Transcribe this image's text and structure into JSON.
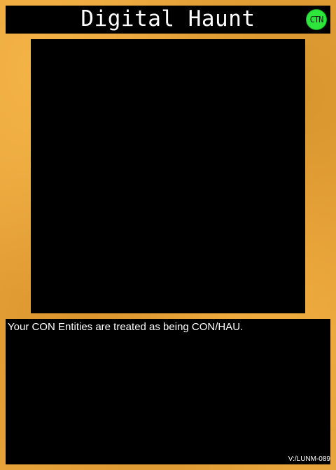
{
  "card": {
    "title": "Digital Haunt",
    "badge": "CTN",
    "effect_text": "Your CON Entities are treated as being CON/HAU.",
    "card_id": "V:/LUNM-089"
  },
  "colors": {
    "frame": "#e7a53b",
    "panel": "#000000",
    "badge": "#2ee53c",
    "text": "#ffffff"
  }
}
